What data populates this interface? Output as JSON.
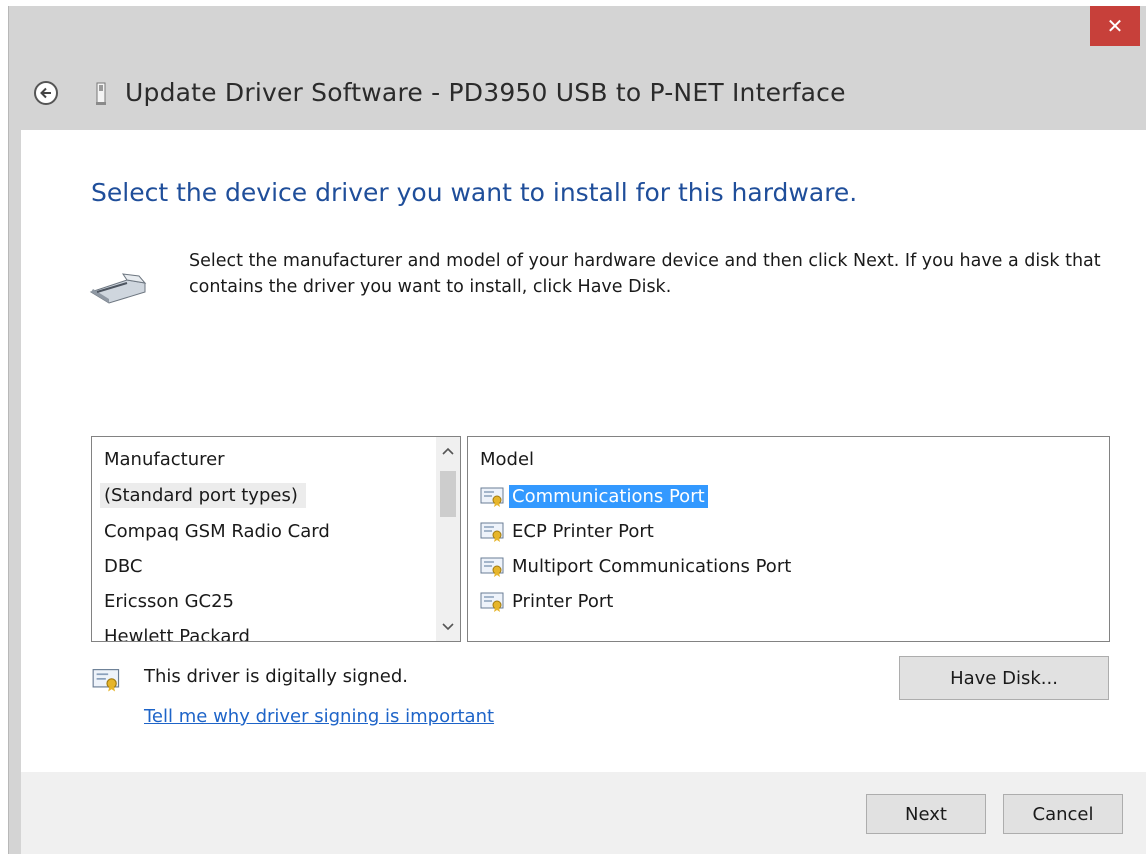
{
  "window": {
    "title": "Update Driver Software - PD3950 USB to P-NET Interface",
    "close_glyph": "✕"
  },
  "page": {
    "heading": "Select the device driver you want to install for this hardware.",
    "description": "Select the manufacturer and model of your hardware device and then click Next. If you have a disk that contains the driver you want to install, click Have Disk."
  },
  "manufacturer_list": {
    "header": "Manufacturer",
    "items": [
      "(Standard port types)",
      "Compaq GSM Radio Card",
      "DBC",
      "Ericsson GC25",
      "Hewlett Packard"
    ],
    "selected_index": 0
  },
  "model_list": {
    "header": "Model",
    "items": [
      "Communications Port",
      "ECP Printer Port",
      "Multiport Communications Port",
      "Printer Port"
    ],
    "selected_index": 0
  },
  "signing": {
    "status_text": "This driver is digitally signed.",
    "link_text": "Tell me why driver signing is important"
  },
  "buttons": {
    "have_disk": "Have Disk...",
    "next": "Next",
    "cancel": "Cancel"
  },
  "colors": {
    "heading": "#1f4e9a",
    "selection": "#3399ff",
    "link": "#1e64c8",
    "close": "#c7403a"
  },
  "icons": {
    "back": "back-arrow-icon",
    "usb": "usb-device-icon",
    "port": "port-connector-icon",
    "certificate": "certificate-icon"
  }
}
